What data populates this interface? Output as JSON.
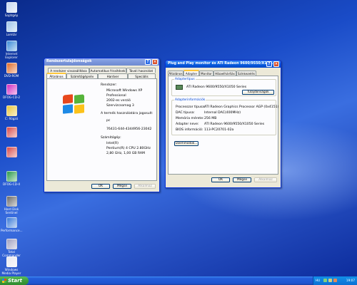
{
  "desktop": {
    "icons": [
      {
        "label": "Sajátgép",
        "color": "#c8d8f0"
      },
      {
        "label": "Lomtár",
        "color": "#9ec4ea"
      },
      {
        "label": "Internet Explorer",
        "color": "#3a8ad8"
      },
      {
        "label": "DVD-ROM",
        "color": "#e06b2a"
      },
      {
        "label": "DFOG-CD-2",
        "color": "#d02ac0"
      },
      {
        "label": "C: Rógzó",
        "color": "#e8c63a"
      },
      {
        "label": "",
        "color": "#d84a4a"
      },
      {
        "label": "",
        "color": "#d84a4a"
      },
      {
        "label": "DFOG-CD-4",
        "color": "#2a9a4a"
      },
      {
        "label": "Hard Disk Sentinel",
        "color": "#6a6a6a"
      },
      {
        "label": "Performance...",
        "color": "#3a7ad8"
      },
      {
        "label": "Total Commander",
        "color": "#a0a0c0"
      },
      {
        "label": "Windows Media Player",
        "color": "#e8e8f0"
      }
    ]
  },
  "sysprops": {
    "title": "Rendszertulajdonságok",
    "tabs_row1": [
      "A rendszer visszaállítása",
      "Automatikus frissítések",
      "Távoli használat"
    ],
    "tabs_row2": [
      "Általános",
      "Számítógépnév",
      "Hardver",
      "Speciális"
    ],
    "system_label": "Rendszer:",
    "system_lines": [
      "Microsoft Windows XP",
      "Professional",
      "2002-es verzió",
      "Szervizcsomag 3"
    ],
    "licensed_label": "A termék használatára jogosult:",
    "licensed_user": "pc",
    "product_id": "76431-644-4344956-23042",
    "computer_label": "Számítógép:",
    "computer_lines": [
      "Intel(R)",
      "Pentium(R) 4 CPU 2.80GHz",
      "2,80 GHz, 1,00 GB RAM"
    ],
    "buttons": {
      "ok": "OK",
      "cancel": "Mégse",
      "apply": "Alkalmaz"
    }
  },
  "pnp": {
    "title": "Plug and Play monitor és ATI Radeon 9600/9550/X10...",
    "tabs": [
      "Általános",
      "Adapter",
      "Monitor",
      "Hibaelhárítás",
      "Színkezelés"
    ],
    "adapter_type_group": "Adaptertípus",
    "adapter_name": "ATI Radeon 9600/9550/X1050 Series",
    "properties_button": "Tulajdonságok",
    "adapter_info_group": "Adapterinformációk",
    "info_rows": [
      {
        "k": "Processzor típusa:",
        "v": "ATI Radeon Graphics Processor AGP (0x4151)"
      },
      {
        "k": "DAC típusa:",
        "v": "Internal DAC(400MHz)"
      },
      {
        "k": "Memória mérete:",
        "v": "256 MB"
      },
      {
        "k": "Adapter neve:",
        "v": "ATI Radeon 9600/9550/X1050 Series"
      },
      {
        "k": "BIOS információ:",
        "v": "113-PC20701-02a"
      }
    ],
    "list_modes_button": "Üzemmódok...",
    "buttons": {
      "ok": "OK",
      "cancel": "Mégse",
      "apply": "Alkalmaz"
    }
  },
  "taskbar": {
    "start_label": "Start",
    "language": "HU",
    "clock": "19:07"
  }
}
